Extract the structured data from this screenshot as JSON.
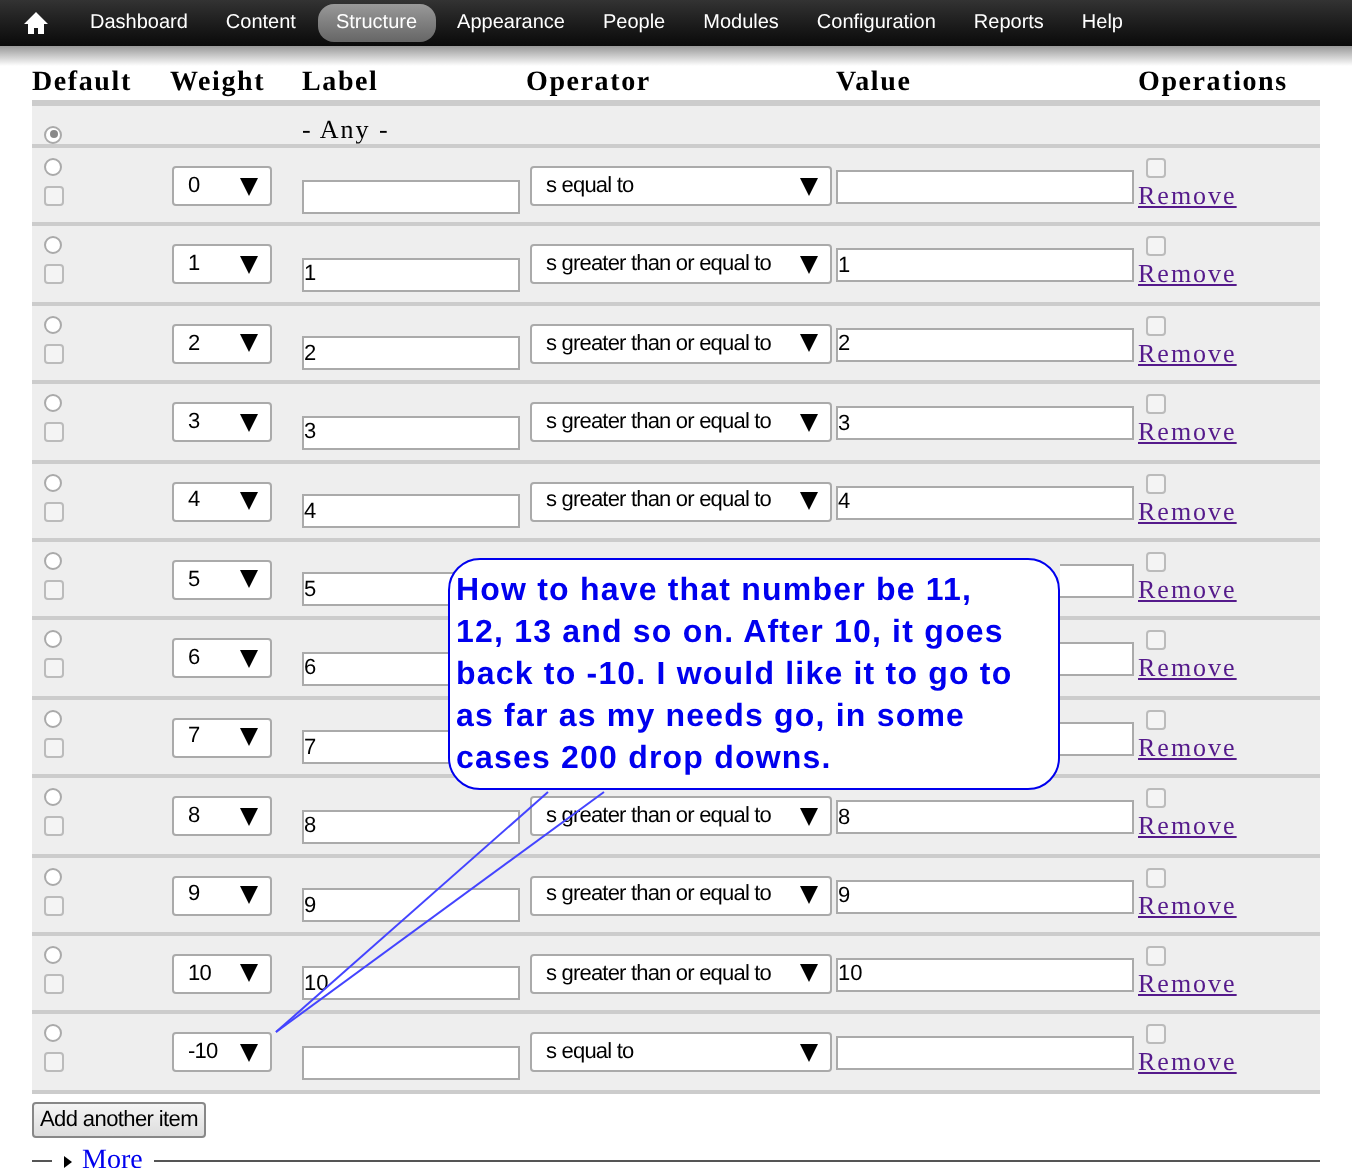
{
  "nav": [
    {
      "label": "Dashboard",
      "selected": false
    },
    {
      "label": "Content",
      "selected": false
    },
    {
      "label": "Structure",
      "selected": true
    },
    {
      "label": "Appearance",
      "selected": false
    },
    {
      "label": "People",
      "selected": false
    },
    {
      "label": "Modules",
      "selected": false
    },
    {
      "label": "Configuration",
      "selected": false
    },
    {
      "label": "Reports",
      "selected": false
    },
    {
      "label": "Help",
      "selected": false
    }
  ],
  "table": {
    "columns": [
      "Default",
      "Weight",
      "Label",
      "Operator",
      "Value",
      "Operations"
    ],
    "any_row": {
      "default": true,
      "label": "- Any -"
    },
    "rows": [
      {
        "default": false,
        "checked": false,
        "weight": "0",
        "operator": "s equal to",
        "remove_checked": false,
        "remove": "Remove"
      },
      {
        "default": false,
        "checked": false,
        "weight": "1",
        "label": "1",
        "operator": "s greater than or equal to",
        "value": "1",
        "remove_checked": false,
        "remove": "Remove"
      },
      {
        "default": false,
        "checked": false,
        "weight": "2",
        "label": "2",
        "operator": "s greater than or equal to",
        "value": "2",
        "remove_checked": false,
        "remove": "Remove"
      },
      {
        "default": false,
        "checked": false,
        "weight": "3",
        "label": "3",
        "operator": "s greater than or equal to",
        "value": "3",
        "remove_checked": false,
        "remove": "Remove"
      },
      {
        "default": false,
        "checked": false,
        "weight": "4",
        "label": "4",
        "operator": "s greater than or equal to",
        "value": "4",
        "remove_checked": false,
        "remove": "Remove"
      },
      {
        "default": false,
        "checked": false,
        "weight": "5",
        "label": "5",
        "remove_checked": false,
        "remove": "Remove"
      },
      {
        "default": false,
        "checked": false,
        "weight": "6",
        "label": "6",
        "remove_checked": false,
        "remove": "Remove"
      },
      {
        "default": false,
        "checked": false,
        "weight": "7",
        "label": "7",
        "remove_checked": false,
        "remove": "Remove"
      },
      {
        "default": false,
        "checked": false,
        "weight": "8",
        "label": "8",
        "operator": "s greater than or equal to",
        "value": "8",
        "remove_checked": false,
        "remove": "Remove"
      },
      {
        "default": false,
        "checked": false,
        "weight": "9",
        "label": "9",
        "operator": "s greater than or equal to",
        "value": "9",
        "remove_checked": false,
        "remove": "Remove"
      },
      {
        "default": false,
        "checked": false,
        "weight": "10",
        "label": "10",
        "operator": "s greater than or equal to",
        "value": "10",
        "remove_checked": false,
        "remove": "Remove"
      },
      {
        "default": false,
        "checked": false,
        "weight": "-10",
        "operator": "s equal to",
        "remove_checked": false,
        "remove": "Remove"
      }
    ]
  },
  "add_button": "Add another item",
  "more_link": "More",
  "callout": [
    "How to have that number be 11,",
    "12, 13 and so on. After 10, it goes",
    "back to -10. I would like it to go to",
    "as far as my needs go, in some",
    "cases 200 drop downs."
  ]
}
